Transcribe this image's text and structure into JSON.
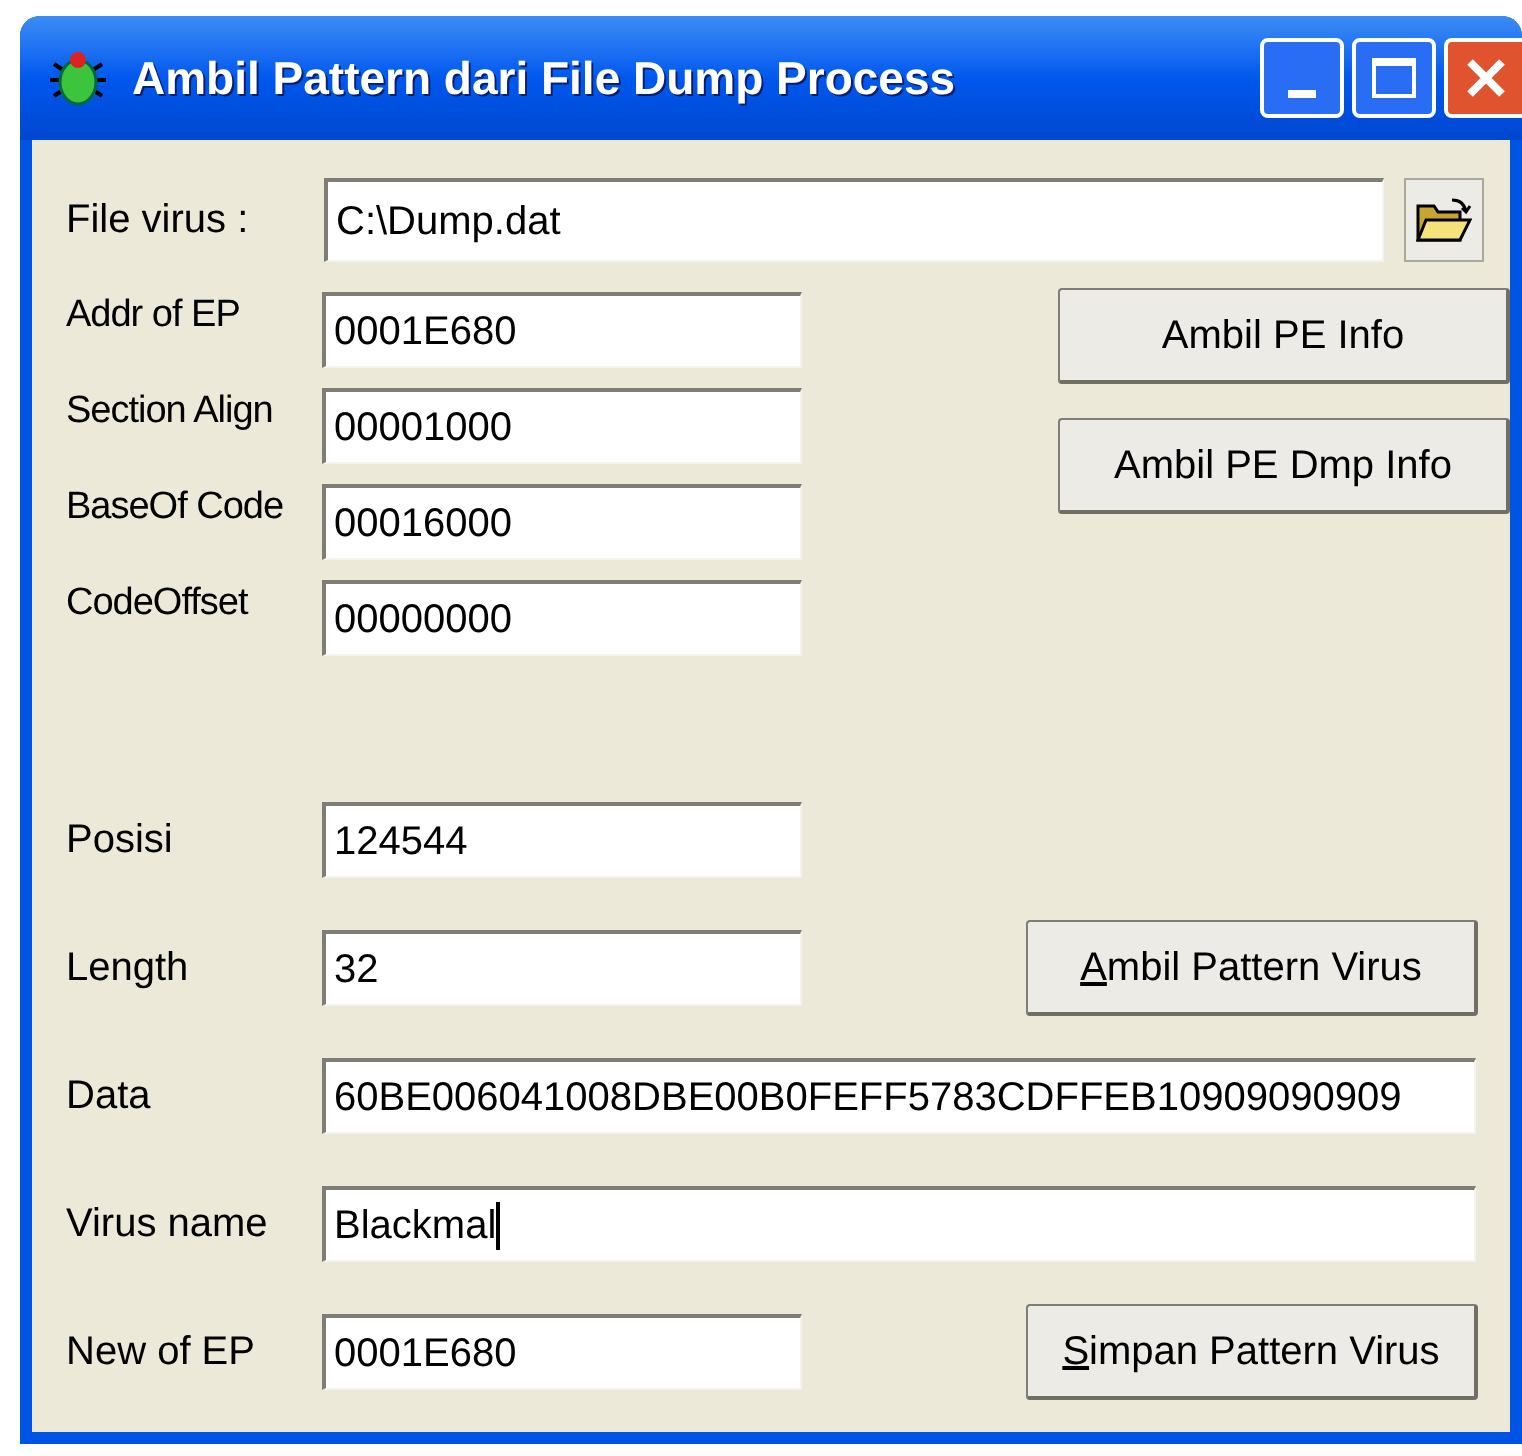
{
  "window": {
    "title": "Ambil Pattern dari File Dump Process"
  },
  "file_row": {
    "label": "File virus :",
    "value": "C:\\Dump.dat"
  },
  "pe_fields": [
    {
      "label": "Addr of EP",
      "value": "0001E680"
    },
    {
      "label": "Section Align",
      "value": "00001000"
    },
    {
      "label": "BaseOf Code",
      "value": "00016000"
    },
    {
      "label": "CodeOffset",
      "value": "00000000"
    }
  ],
  "pe_buttons": [
    {
      "label": "Ambil PE Info",
      "underlined_first": false
    },
    {
      "label": "Ambil PE Dmp Info",
      "underlined_first": false
    }
  ],
  "pattern_rows": [
    {
      "kind": "short",
      "label": "Posisi",
      "value": "124544"
    },
    {
      "kind": "short",
      "label": "Length",
      "value": "32",
      "button": {
        "label": "Ambil Pattern Virus",
        "underlined_first": true
      }
    },
    {
      "kind": "long",
      "label": "Data",
      "value": "60BE006041008DBE00B0FEFF5783CDFFEB10909090909"
    },
    {
      "kind": "long",
      "label": "Virus name",
      "value": "Blackmal",
      "focused": true
    },
    {
      "kind": "short",
      "label": "New of EP",
      "value": "0001E680",
      "button": {
        "label": "Simpan Pattern Virus",
        "underlined_first": true
      }
    }
  ]
}
